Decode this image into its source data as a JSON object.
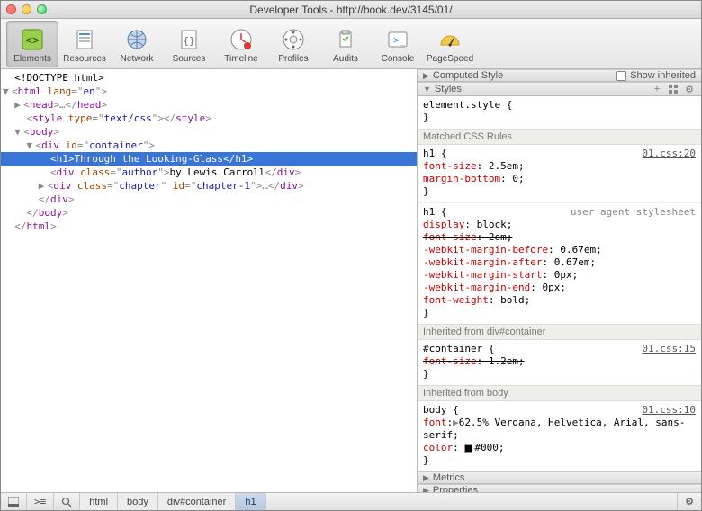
{
  "window": {
    "title": "Developer Tools - http://book.dev/3145/01/"
  },
  "toolbar": {
    "items": [
      {
        "label": "Elements",
        "icon": "elements-icon",
        "active": true
      },
      {
        "label": "Resources",
        "icon": "resources-icon"
      },
      {
        "label": "Network",
        "icon": "network-icon"
      },
      {
        "label": "Sources",
        "icon": "sources-icon"
      },
      {
        "label": "Timeline",
        "icon": "timeline-icon"
      },
      {
        "label": "Profiles",
        "icon": "profiles-icon"
      },
      {
        "label": "Audits",
        "icon": "audits-icon"
      },
      {
        "label": "Console",
        "icon": "console-icon"
      },
      {
        "label": "PageSpeed",
        "icon": "pagespeed-icon"
      }
    ]
  },
  "dom": {
    "doctype": "<!DOCTYPE html>",
    "html_open": "<html lang=\"en\">",
    "head": "<head>…</head>",
    "style": "<style type=\"text/css\"></style>",
    "body_open": "<body>",
    "container_open": "<div id=\"container\">",
    "h1_open_tag": "<h1>",
    "h1_text": "Through the Looking-Glass",
    "h1_close_tag": "</h1>",
    "author_open": "<div class=\"author\">",
    "author_text": "by Lewis Carroll",
    "author_close": "</div>",
    "chapter": "<div class=\"chapter\" id=\"chapter-1\">…</div>",
    "container_close": "</div>",
    "body_close": "</body>",
    "html_close": "</html>"
  },
  "styles": {
    "computed_label": "Computed Style",
    "show_inherited_label": "Show inherited",
    "styles_label": "Styles",
    "element_style_selector": "element.style {",
    "matched_header": "Matched CSS Rules",
    "rule1": {
      "selector": "h1 {",
      "link": "01.css:20",
      "p1n": "font-size",
      "p1v": "2.5em",
      "p2n": "margin-bottom",
      "p2v": "0"
    },
    "rule2": {
      "selector": "h1 {",
      "ua": "user agent stylesheet",
      "p1n": "display",
      "p1v": "block",
      "p2n": "font-size",
      "p2v": "2em",
      "p3n": "-webkit-margin-before",
      "p3v": "0.67em",
      "p4n": "-webkit-margin-after",
      "p4v": "0.67em",
      "p5n": "-webkit-margin-start",
      "p5v": "0px",
      "p6n": "-webkit-margin-end",
      "p6v": "0px",
      "p7n": "font-weight",
      "p7v": "bold"
    },
    "inherit1": "Inherited from div#container",
    "rule3": {
      "selector": "#container {",
      "link": "01.css:15",
      "p1n": "font-size",
      "p1v": "1.2em"
    },
    "inherit2": "Inherited from body",
    "rule4": {
      "selector": "body {",
      "link": "01.css:10",
      "p1n": "font",
      "p1v": "62.5% Verdana, Helvetica, Arial, sans-serif",
      "p2n": "color",
      "p2v": "#000"
    },
    "metrics_label": "Metrics",
    "properties_label": "Properties"
  },
  "breadcrumb": {
    "items": [
      "html",
      "body",
      "div#container",
      "h1"
    ]
  }
}
